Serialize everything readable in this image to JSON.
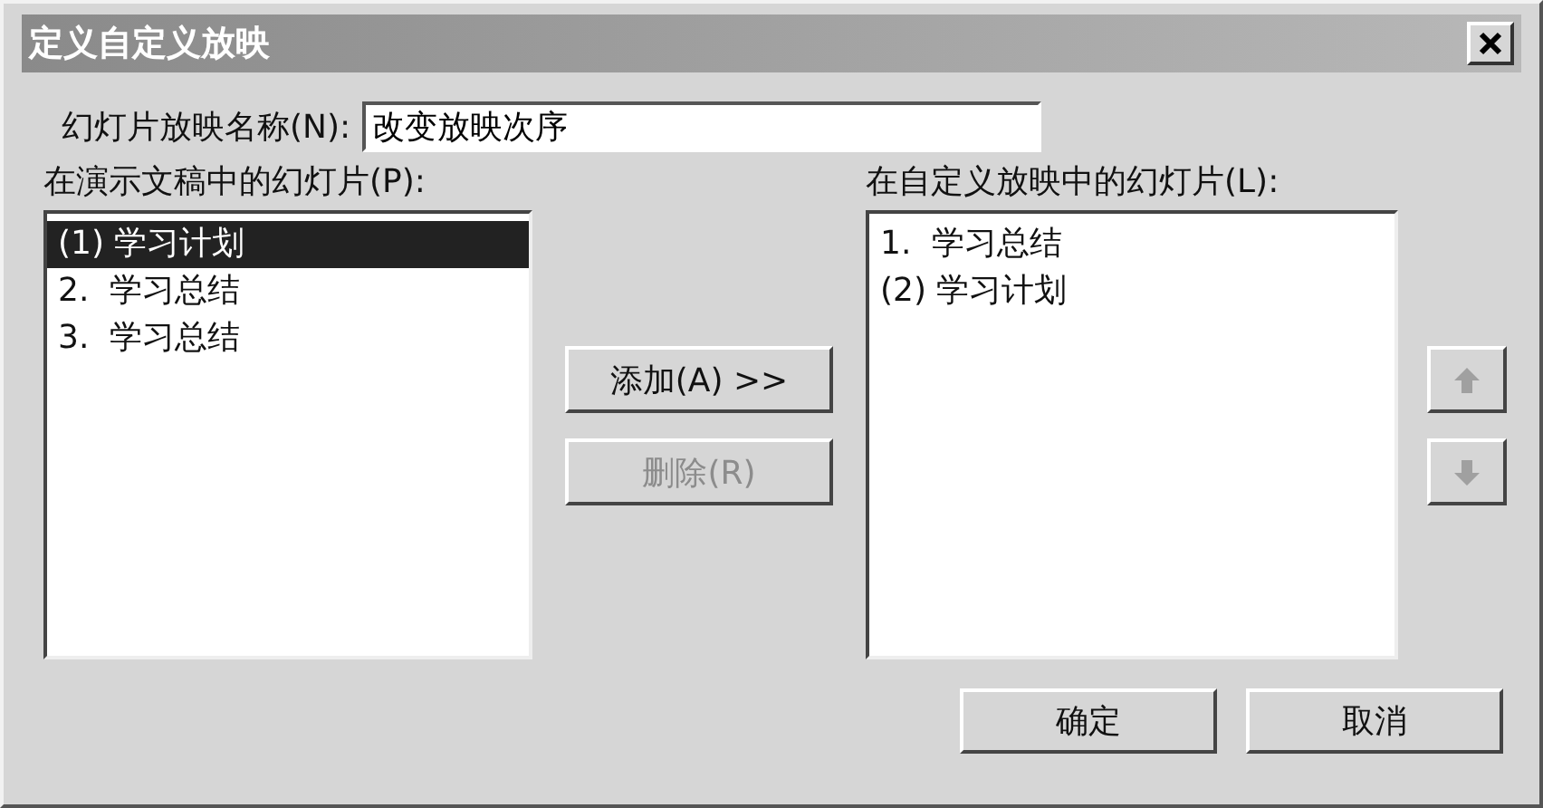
{
  "window": {
    "title": "定义自定义放映"
  },
  "name_field": {
    "label": "幻灯片放映名称(N):",
    "value": "改变放映次序"
  },
  "available": {
    "label": "在演示文稿中的幻灯片(P):",
    "items": [
      {
        "text": "(1) 学习计划",
        "selected": true
      },
      {
        "text": "2.  学习总结",
        "selected": false
      },
      {
        "text": "3.  学习总结",
        "selected": false
      }
    ]
  },
  "actions": [
    {
      "label": "添加(A) >>",
      "disabled": false
    },
    {
      "label": "删除(R)",
      "disabled": true
    }
  ],
  "custom": {
    "label": "在自定义放映中的幻灯片(L):",
    "items": [
      {
        "text": "1.  学习总结",
        "selected": false
      },
      {
        "text": "(2) 学习计划",
        "selected": false
      }
    ]
  },
  "order_buttons": [
    {
      "kind": "up",
      "disabled": true
    },
    {
      "kind": "down",
      "disabled": true
    }
  ],
  "footer_buttons": [
    "确定",
    "取消"
  ]
}
